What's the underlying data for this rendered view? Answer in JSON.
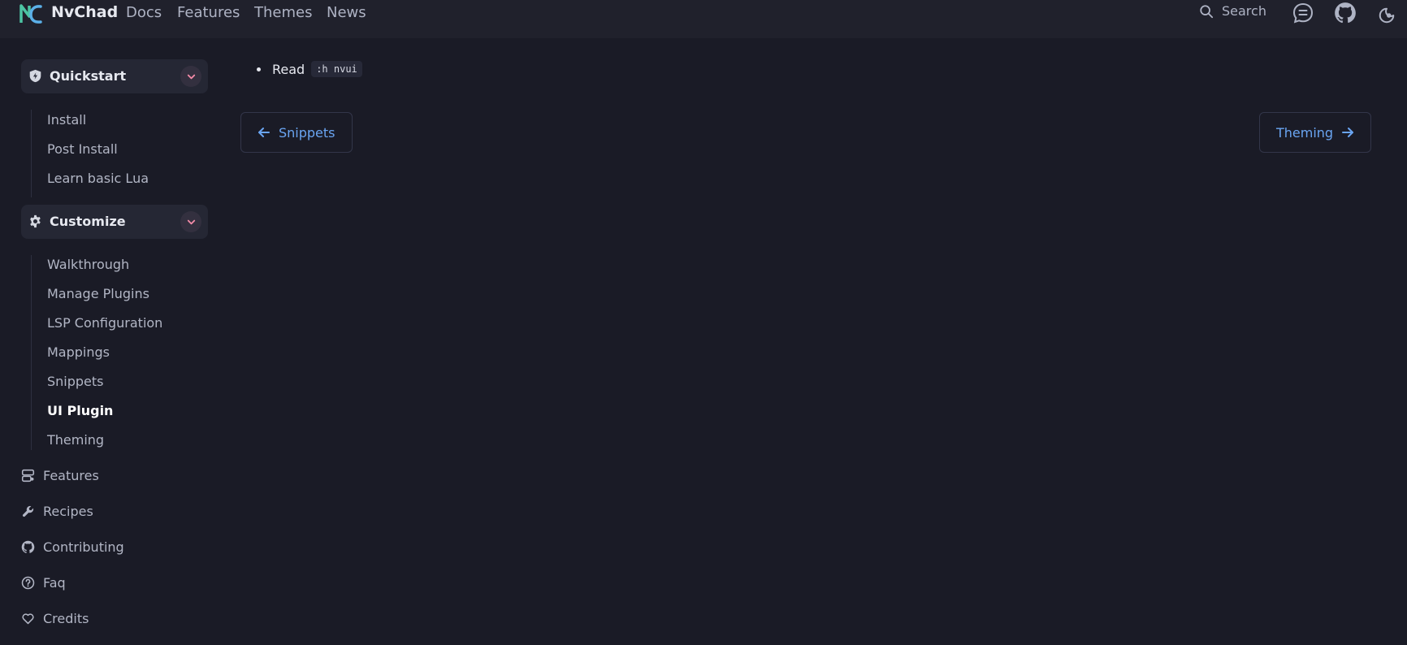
{
  "header": {
    "brand": "NvChad",
    "nav": [
      "Docs",
      "Features",
      "Themes",
      "News"
    ],
    "search_label": "Search"
  },
  "sidebar": {
    "groups": [
      {
        "label": "Quickstart",
        "icon": "shield-icon",
        "items": [
          "Install",
          "Post Install",
          "Learn basic Lua"
        ]
      },
      {
        "label": "Customize",
        "icon": "gear-icon",
        "items": [
          "Walkthrough",
          "Manage Plugins",
          "LSP Configuration",
          "Mappings",
          "Snippets",
          "UI Plugin",
          "Theming"
        ],
        "active": "UI Plugin"
      }
    ],
    "links": [
      {
        "label": "Features",
        "icon": "server-icon"
      },
      {
        "label": "Recipes",
        "icon": "wrench-icon"
      },
      {
        "label": "Contributing",
        "icon": "github-icon"
      },
      {
        "label": "Faq",
        "icon": "question-icon"
      },
      {
        "label": "Credits",
        "icon": "heart-icon"
      }
    ]
  },
  "main": {
    "bullet_text": "Read",
    "bullet_code": ":h nvui",
    "prev_label": "Snippets",
    "next_label": "Theming"
  },
  "colors": {
    "background": "#1a1b26",
    "topbar": "#20212c",
    "accent_link": "#6aa5f2",
    "chevron": "#f38ba8"
  }
}
